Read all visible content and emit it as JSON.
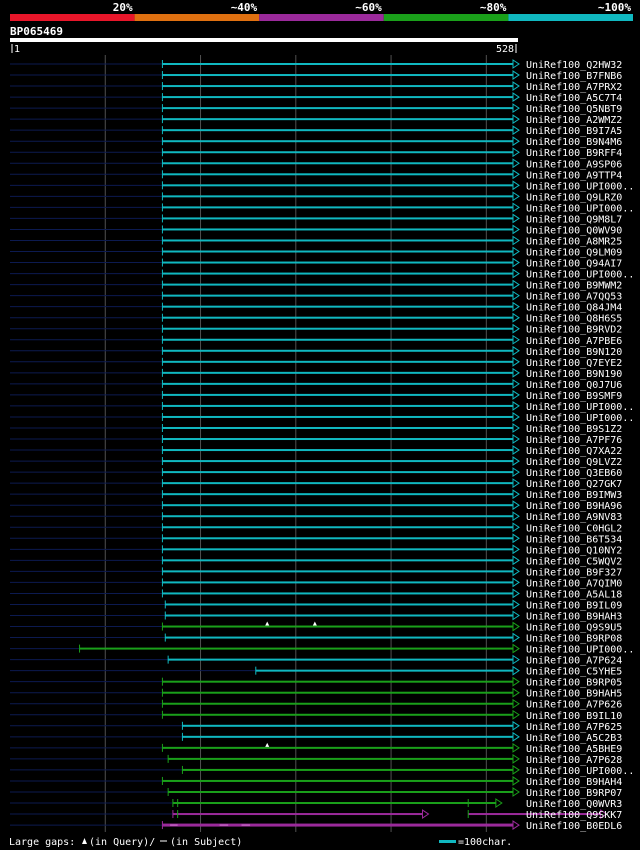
{
  "chart_data": {
    "type": "alignment-overview",
    "identity_legend": [
      {
        "label": "20%",
        "color": "#e8162a"
      },
      {
        "label": "~40%",
        "color": "#e07010"
      },
      {
        "label": "~60%",
        "color": "#9b2a9b"
      },
      {
        "label": "~80%",
        "color": "#1aa01a"
      },
      {
        "label": "~100%",
        "color": "#10b8c0"
      }
    ],
    "query": {
      "name": "BP065469",
      "start": "1",
      "end": "528",
      "length": 528
    },
    "colors": {
      "cyan": "#10b8c0",
      "green": "#1aa01a",
      "purple": "#9b2a9b",
      "navy": "#0c1a50",
      "grid": "#505050"
    },
    "hits": [
      {
        "label": "UniRef100_Q2HW32",
        "q_start": 160,
        "q_end": 528,
        "color": "cyan"
      },
      {
        "label": "UniRef100_B7FNB6",
        "q_start": 160,
        "q_end": 528,
        "color": "cyan"
      },
      {
        "label": "UniRef100_A7PRX2",
        "q_start": 160,
        "q_end": 528,
        "color": "cyan"
      },
      {
        "label": "UniRef100_A5C7T4",
        "q_start": 160,
        "q_end": 528,
        "color": "cyan"
      },
      {
        "label": "UniRef100_Q5NBT9",
        "q_start": 160,
        "q_end": 528,
        "color": "cyan"
      },
      {
        "label": "UniRef100_A2WMZ2",
        "q_start": 160,
        "q_end": 528,
        "color": "cyan"
      },
      {
        "label": "UniRef100_B9I7A5",
        "q_start": 160,
        "q_end": 528,
        "color": "cyan"
      },
      {
        "label": "UniRef100_B9N4M6",
        "q_start": 160,
        "q_end": 528,
        "color": "cyan"
      },
      {
        "label": "UniRef100_B9RFF4",
        "q_start": 160,
        "q_end": 528,
        "color": "cyan"
      },
      {
        "label": "UniRef100_A9SP06",
        "q_start": 160,
        "q_end": 528,
        "color": "cyan"
      },
      {
        "label": "UniRef100_A9TTP4",
        "q_start": 160,
        "q_end": 528,
        "color": "cyan"
      },
      {
        "label": "UniRef100_UPI000..",
        "q_start": 160,
        "q_end": 528,
        "color": "cyan"
      },
      {
        "label": "UniRef100_Q9LRZ0",
        "q_start": 160,
        "q_end": 528,
        "color": "cyan"
      },
      {
        "label": "UniRef100_UPI000..",
        "q_start": 160,
        "q_end": 528,
        "color": "cyan"
      },
      {
        "label": "UniRef100_Q9M8L7",
        "q_start": 160,
        "q_end": 528,
        "color": "cyan"
      },
      {
        "label": "UniRef100_Q0WV90",
        "q_start": 160,
        "q_end": 528,
        "color": "cyan"
      },
      {
        "label": "UniRef100_A8MR25",
        "q_start": 160,
        "q_end": 528,
        "color": "cyan"
      },
      {
        "label": "UniRef100_Q9LM09",
        "q_start": 160,
        "q_end": 528,
        "color": "cyan"
      },
      {
        "label": "UniRef100_Q94AI7",
        "q_start": 160,
        "q_end": 528,
        "color": "cyan"
      },
      {
        "label": "UniRef100_UPI000..",
        "q_start": 160,
        "q_end": 528,
        "color": "cyan"
      },
      {
        "label": "UniRef100_B9MWM2",
        "q_start": 160,
        "q_end": 528,
        "color": "cyan"
      },
      {
        "label": "UniRef100_A7QQ53",
        "q_start": 160,
        "q_end": 528,
        "color": "cyan"
      },
      {
        "label": "UniRef100_Q84JM4",
        "q_start": 160,
        "q_end": 528,
        "color": "cyan"
      },
      {
        "label": "UniRef100_Q8H6S5",
        "q_start": 160,
        "q_end": 528,
        "color": "cyan"
      },
      {
        "label": "UniRef100_B9RVD2",
        "q_start": 160,
        "q_end": 528,
        "color": "cyan"
      },
      {
        "label": "UniRef100_A7PBE6",
        "q_start": 160,
        "q_end": 528,
        "color": "cyan"
      },
      {
        "label": "UniRef100_B9N120",
        "q_start": 160,
        "q_end": 528,
        "color": "cyan"
      },
      {
        "label": "UniRef100_Q7EYE2",
        "q_start": 160,
        "q_end": 528,
        "color": "cyan"
      },
      {
        "label": "UniRef100_B9N190",
        "q_start": 160,
        "q_end": 528,
        "color": "cyan"
      },
      {
        "label": "UniRef100_Q0J7U6",
        "q_start": 160,
        "q_end": 528,
        "color": "cyan"
      },
      {
        "label": "UniRef100_B9SMF9",
        "q_start": 160,
        "q_end": 528,
        "color": "cyan"
      },
      {
        "label": "UniRef100_UPI000..",
        "q_start": 160,
        "q_end": 528,
        "color": "cyan"
      },
      {
        "label": "UniRef100_UPI000..",
        "q_start": 160,
        "q_end": 528,
        "color": "cyan"
      },
      {
        "label": "UniRef100_B9S1Z2",
        "q_start": 160,
        "q_end": 528,
        "color": "cyan"
      },
      {
        "label": "UniRef100_A7PF76",
        "q_start": 160,
        "q_end": 528,
        "color": "cyan"
      },
      {
        "label": "UniRef100_Q7XA22",
        "q_start": 160,
        "q_end": 528,
        "color": "cyan"
      },
      {
        "label": "UniRef100_Q9LVZ2",
        "q_start": 160,
        "q_end": 528,
        "color": "cyan"
      },
      {
        "label": "UniRef100_Q3EB60",
        "q_start": 160,
        "q_end": 528,
        "color": "cyan"
      },
      {
        "label": "UniRef100_Q27GK7",
        "q_start": 160,
        "q_end": 528,
        "color": "cyan"
      },
      {
        "label": "UniRef100_B9IMW3",
        "q_start": 160,
        "q_end": 528,
        "color": "cyan"
      },
      {
        "label": "UniRef100_B9HA96",
        "q_start": 160,
        "q_end": 528,
        "color": "cyan"
      },
      {
        "label": "UniRef100_A9NV83",
        "q_start": 160,
        "q_end": 528,
        "color": "cyan"
      },
      {
        "label": "UniRef100_C0HGL2",
        "q_start": 160,
        "q_end": 528,
        "color": "cyan"
      },
      {
        "label": "UniRef100_B6T534",
        "q_start": 160,
        "q_end": 528,
        "color": "cyan"
      },
      {
        "label": "UniRef100_Q10NY2",
        "q_start": 160,
        "q_end": 528,
        "color": "cyan"
      },
      {
        "label": "UniRef100_C5WQV2",
        "q_start": 160,
        "q_end": 528,
        "color": "cyan"
      },
      {
        "label": "UniRef100_B9F327",
        "q_start": 160,
        "q_end": 528,
        "color": "cyan"
      },
      {
        "label": "UniRef100_A7QIM0",
        "q_start": 160,
        "q_end": 528,
        "color": "cyan"
      },
      {
        "label": "UniRef100_A5AL18",
        "q_start": 160,
        "q_end": 528,
        "color": "cyan"
      },
      {
        "label": "UniRef100_B9IL09",
        "q_start": 163,
        "q_end": 528,
        "color": "cyan"
      },
      {
        "label": "UniRef100_B9HAH3",
        "q_start": 163,
        "q_end": 528,
        "color": "cyan"
      },
      {
        "label": "UniRef100_Q9S9U5",
        "q_start": 160,
        "q_end": 528,
        "color": "green",
        "gaps": [
          270,
          320
        ]
      },
      {
        "label": "UniRef100_B9RP08",
        "q_start": 163,
        "q_end": 528,
        "color": "cyan"
      },
      {
        "label": "UniRef100_UPI000..",
        "q_start": 73,
        "q_end": 528,
        "color": "green"
      },
      {
        "label": "UniRef100_A7P624",
        "q_start": 166,
        "q_end": 528,
        "color": "cyan"
      },
      {
        "label": "UniRef100_C5YHE5",
        "q_start": 258,
        "q_end": 528,
        "color": "cyan"
      },
      {
        "label": "UniRef100_B9RP05",
        "q_start": 160,
        "q_end": 528,
        "color": "green"
      },
      {
        "label": "UniRef100_B9HAH5",
        "q_start": 160,
        "q_end": 528,
        "color": "green"
      },
      {
        "label": "UniRef100_A7P626",
        "q_start": 160,
        "q_end": 528,
        "color": "green"
      },
      {
        "label": "UniRef100_B9IL10",
        "q_start": 160,
        "q_end": 528,
        "color": "green"
      },
      {
        "label": "UniRef100_A7P625",
        "q_start": 181,
        "q_end": 528,
        "color": "cyan"
      },
      {
        "label": "UniRef100_A5C2B3",
        "q_start": 181,
        "q_end": 528,
        "color": "cyan"
      },
      {
        "label": "UniRef100_A5BHE9",
        "q_start": 160,
        "q_end": 528,
        "color": "green",
        "gaps": [
          270
        ]
      },
      {
        "label": "UniRef100_A7P628",
        "q_start": 166,
        "q_end": 528,
        "color": "green"
      },
      {
        "label": "UniRef100_UPI000..",
        "q_start": 181,
        "q_end": 528,
        "color": "green"
      },
      {
        "label": "UniRef100_B9HAH4",
        "q_start": 160,
        "q_end": 528,
        "color": "green"
      },
      {
        "label": "UniRef100_B9RP07",
        "q_start": 166,
        "q_end": 528,
        "color": "green"
      },
      {
        "label": "UniRef100_Q0WVR3",
        "q_start": 171,
        "q_end": 510,
        "color": "green",
        "ticks": [
          176,
          481
        ]
      },
      {
        "label": "UniRef100_Q9SKK7",
        "q_start": 171,
        "q_end": 433,
        "color": "purple",
        "second_segment": [
          481,
          620
        ],
        "ticks": [
          176,
          481
        ]
      },
      {
        "label": "UniRef100_B0EDL6",
        "q_start": 160,
        "q_end": 528,
        "color": "purple",
        "dashed": true
      }
    ],
    "footer": {
      "large_gaps_label": "Large gaps:",
      "gaps_in_query": "(in Query)/",
      "gaps_in_subject": "(in Subject)",
      "scale_label": "=100char."
    }
  }
}
